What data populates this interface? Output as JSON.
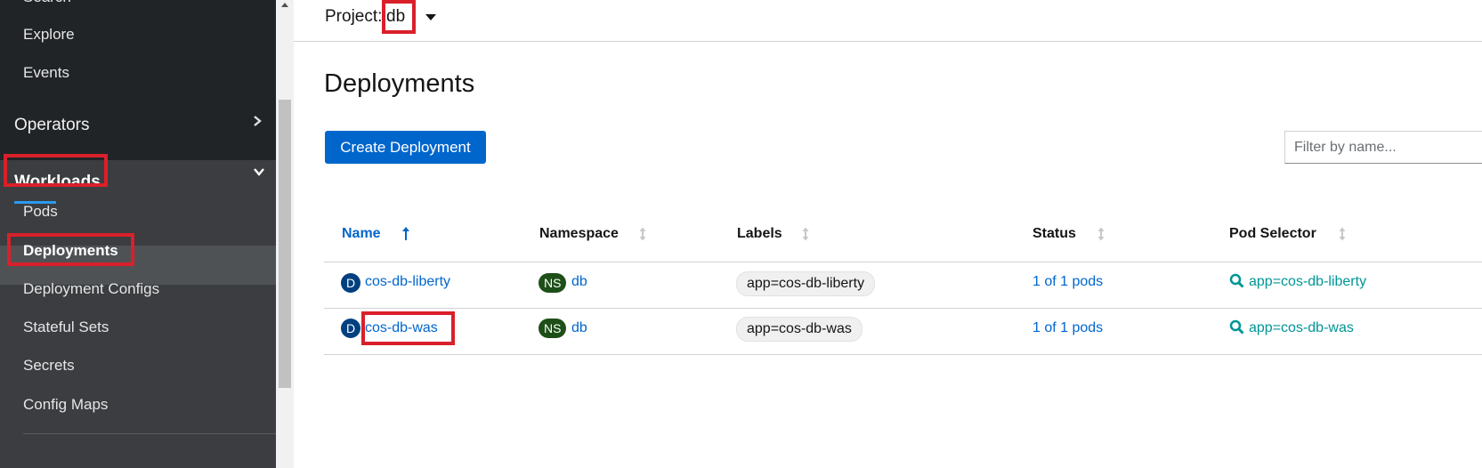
{
  "sidebar": {
    "search_label": "Search",
    "explore_label": "Explore",
    "events_label": "Events",
    "operators_label": "Operators",
    "workloads_label": "Workloads",
    "items": [
      {
        "label": "Pods"
      },
      {
        "label": "Deployments"
      },
      {
        "label": "Deployment Configs"
      },
      {
        "label": "Stateful Sets"
      },
      {
        "label": "Secrets"
      },
      {
        "label": "Config Maps"
      }
    ]
  },
  "header": {
    "project_label": "Project:",
    "project_value": "db"
  },
  "page": {
    "title": "Deployments",
    "create_button": "Create Deployment",
    "filter_placeholder": "Filter by name..."
  },
  "table": {
    "columns": [
      "Name",
      "Namespace",
      "Labels",
      "Status",
      "Pod Selector"
    ],
    "rows": [
      {
        "kind_badge": "D",
        "name": "cos-db-liberty",
        "ns_badge": "NS",
        "namespace": "db",
        "label": "app=cos-db-liberty",
        "status": "1 of 1 pods",
        "selector": "app=cos-db-liberty"
      },
      {
        "kind_badge": "D",
        "name": "cos-db-was",
        "ns_badge": "NS",
        "namespace": "db",
        "label": "app=cos-db-was",
        "status": "1 of 1 pods",
        "selector": "app=cos-db-was"
      }
    ]
  },
  "colors": {
    "sidebar_bg": "#212427",
    "primary": "#0066cc",
    "highlight_box": "#d9202a",
    "ns_badge": "#1e4f18",
    "selector_link": "#009596"
  }
}
